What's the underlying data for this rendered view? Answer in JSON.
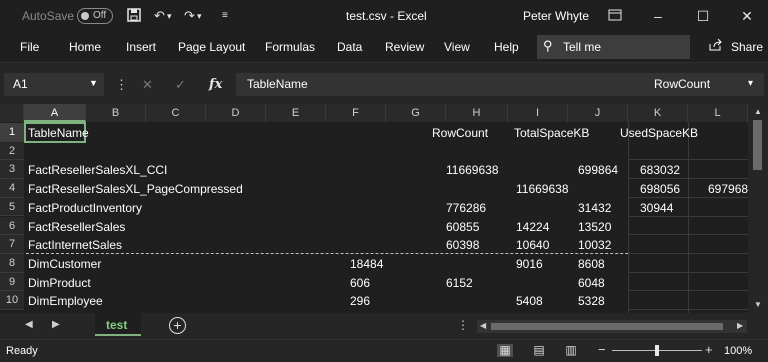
{
  "window": {
    "title": "test.csv  -  Excel",
    "user": "Peter Whyte",
    "autosave_label": "AutoSave",
    "autosave_state": "Off",
    "minimize_icon": "minimize-icon",
    "restore_icon": "restore-icon",
    "close_icon": "close-icon"
  },
  "ribbon": {
    "tabs": [
      "File",
      "Home",
      "Insert",
      "Page Layout",
      "Formulas",
      "Data",
      "Review",
      "View",
      "Help"
    ],
    "tell_me": "Tell me",
    "share": "Share"
  },
  "formula_bar": {
    "name_box": "A1",
    "formula": "TableName",
    "overflow_text": "RowCount"
  },
  "grid": {
    "columns": [
      "A",
      "B",
      "C",
      "D",
      "E",
      "F",
      "G",
      "H",
      "I",
      "J",
      "K",
      "L"
    ],
    "selected_column": "A",
    "rows": [
      {
        "num": "1",
        "cells": [
          {
            "text": "TableName",
            "col": "A"
          },
          {
            "text": "RowCount",
            "col": "H"
          },
          {
            "text": "TotalSpaceKB",
            "col": "I"
          },
          {
            "text": "UsedSpaceKB",
            "col": "K"
          }
        ]
      },
      {
        "num": "2",
        "cells": []
      },
      {
        "num": "3",
        "cells": [
          {
            "text": "FactResellerSalesXL_CCI",
            "col": "A"
          },
          {
            "text": "11669638",
            "col": "H"
          },
          {
            "text": "699864",
            "col": "J"
          },
          {
            "text": "683032",
            "col": "K"
          }
        ]
      },
      {
        "num": "4",
        "cells": [
          {
            "text": "FactResellerSalesXL_PageCompressed",
            "col": "A"
          },
          {
            "text": "11669638",
            "col": "I"
          },
          {
            "text": "698056",
            "col": "K"
          },
          {
            "text": "697968",
            "col": "L"
          }
        ]
      },
      {
        "num": "5",
        "cells": [
          {
            "text": "FactProductInventory",
            "col": "A"
          },
          {
            "text": "776286",
            "col": "H"
          },
          {
            "text": "31432",
            "col": "J"
          },
          {
            "text": "30944",
            "col": "K"
          }
        ]
      },
      {
        "num": "6",
        "cells": [
          {
            "text": "FactResellerSales",
            "col": "A"
          },
          {
            "text": "60855",
            "col": "H"
          },
          {
            "text": "14224",
            "col": "I"
          },
          {
            "text": "13520",
            "col": "J"
          }
        ]
      },
      {
        "num": "7",
        "cells": [
          {
            "text": "FactInternetSales",
            "col": "A"
          },
          {
            "text": "60398",
            "col": "H"
          },
          {
            "text": "10640",
            "col": "I"
          },
          {
            "text": "10032",
            "col": "J"
          }
        ]
      },
      {
        "num": "8",
        "cells": [
          {
            "text": "DimCustomer",
            "col": "A"
          },
          {
            "text": "18484",
            "col": "G"
          },
          {
            "text": "9016",
            "col": "I"
          },
          {
            "text": "8608",
            "col": "J"
          }
        ]
      },
      {
        "num": "9",
        "cells": [
          {
            "text": "DimProduct",
            "col": "A"
          },
          {
            "text": "606",
            "col": "G"
          },
          {
            "text": "6152",
            "col": "H"
          },
          {
            "text": "6048",
            "col": "J"
          }
        ]
      },
      {
        "num": "10",
        "cells": [
          {
            "text": "DimEmployee",
            "col": "A"
          },
          {
            "text": "296",
            "col": "G"
          },
          {
            "text": "5408",
            "col": "I"
          },
          {
            "text": "5328",
            "col": "J"
          }
        ]
      }
    ]
  },
  "sheets": {
    "active": "test",
    "add_icon": "plus-icon"
  },
  "status": {
    "text": "Ready",
    "zoom": "100%",
    "zoom_fraction": 0.5
  },
  "colors": {
    "accent": "#7fb27f",
    "background": "#1f1f1f"
  }
}
